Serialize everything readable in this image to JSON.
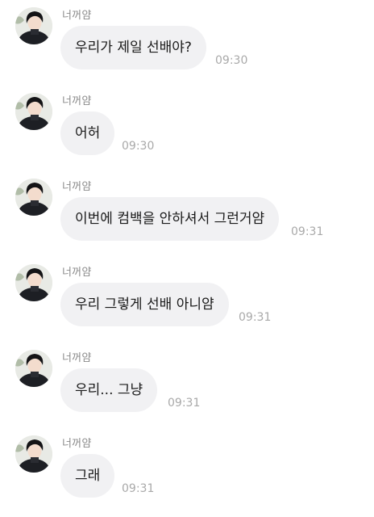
{
  "sender_name": "너꺼얌",
  "messages": [
    {
      "text": "우리가 제일 선배야?",
      "time": "09:30"
    },
    {
      "text": "어허",
      "time": "09:30"
    },
    {
      "text": "이번에 컴백을 안하셔서 그런거얌",
      "time": "09:31"
    },
    {
      "text": "우리 그렇게 선배 아니얌",
      "time": "09:31"
    },
    {
      "text": "우리... 그냥",
      "time": "09:31"
    },
    {
      "text": "그래",
      "time": "09:31"
    }
  ],
  "colors": {
    "bubble_bg": "#f1f1f3",
    "sender_text": "#8a8a8a",
    "time_text": "#a9a9a9"
  }
}
